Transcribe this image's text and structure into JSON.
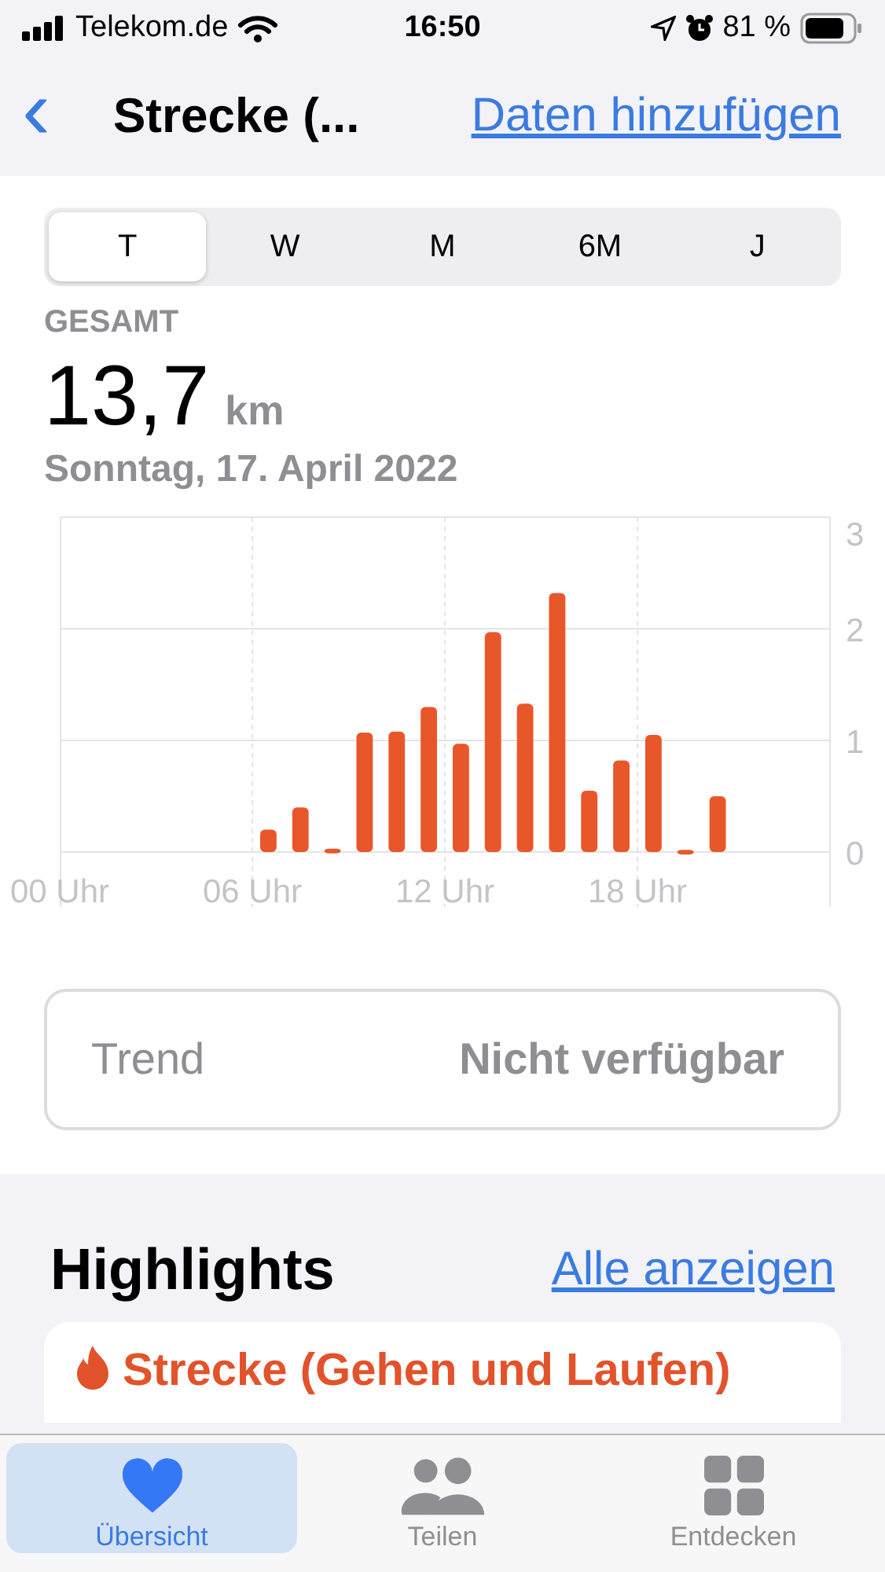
{
  "status_bar": {
    "carrier": "Telekom.de",
    "time": "16:50",
    "battery": "81 %"
  },
  "nav": {
    "back": "‹",
    "title": "Strecke (...",
    "action": "Daten hinzufügen"
  },
  "segments": [
    {
      "label": "T",
      "selected": true
    },
    {
      "label": "W",
      "selected": false
    },
    {
      "label": "M",
      "selected": false
    },
    {
      "label": "6M",
      "selected": false
    },
    {
      "label": "J",
      "selected": false
    }
  ],
  "summary": {
    "label": "GESAMT",
    "value": "13,7",
    "unit": "km",
    "date": "Sonntag, 17. April 2022"
  },
  "chart_data": {
    "type": "bar",
    "x": [
      6.5,
      7.5,
      8.5,
      9.5,
      10.5,
      11.5,
      12.5,
      13.5,
      14.5,
      15.5,
      16.5,
      17.5,
      18.5,
      19.5,
      20.5
    ],
    "values": [
      0.2,
      0.4,
      0.03,
      1.07,
      1.08,
      1.3,
      0.97,
      1.97,
      1.33,
      2.32,
      0.55,
      0.82,
      1.05,
      0.02,
      0.5
    ],
    "grid": true,
    "xlim": [
      0,
      24
    ],
    "ylim": [
      0,
      3
    ],
    "yticks": [
      0,
      1,
      2,
      3
    ],
    "xticks": [
      {
        "value": 0,
        "label": "00 Uhr"
      },
      {
        "value": 6,
        "label": "06 Uhr"
      },
      {
        "value": 12,
        "label": "12 Uhr"
      },
      {
        "value": 18,
        "label": "18 Uhr"
      }
    ]
  },
  "trend": {
    "label": "Trend",
    "value": "Nicht verfügbar"
  },
  "highlights": {
    "title": "Highlights",
    "link": "Alle anzeigen",
    "card_title": "Strecke (Gehen und Laufen)"
  },
  "tabs": [
    {
      "label": "Übersicht",
      "selected": true
    },
    {
      "label": "Teilen",
      "selected": false
    },
    {
      "label": "Entdecken",
      "selected": false
    }
  ]
}
